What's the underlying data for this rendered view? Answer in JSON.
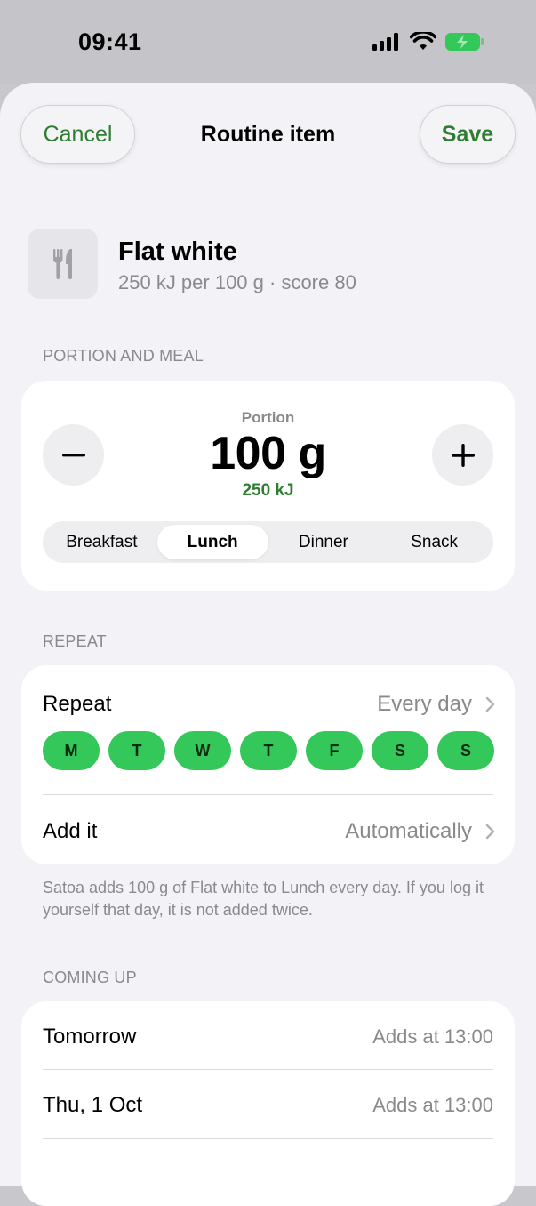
{
  "status_bar": {
    "time": "09:41"
  },
  "nav": {
    "cancel": "Cancel",
    "title": "Routine item",
    "save": "Save"
  },
  "food": {
    "name": "Flat white",
    "subtitle": "250 kJ per 100 g · score 80",
    "icon": "fork-knife-icon"
  },
  "portion_section": {
    "header": "PORTION AND MEAL",
    "label": "Portion",
    "value": "100 g",
    "energy": "250 kJ",
    "meals": [
      "Breakfast",
      "Lunch",
      "Dinner",
      "Snack"
    ],
    "selected_meal": "Lunch"
  },
  "repeat_section": {
    "header": "REPEAT",
    "repeat_label": "Repeat",
    "repeat_value": "Every day",
    "days": [
      "M",
      "T",
      "W",
      "T",
      "F",
      "S",
      "S"
    ],
    "add_label": "Add it",
    "add_value": "Automatically",
    "footnote": "Satoa adds 100 g of Flat white to Lunch every day. If you log it yourself that day, it is not added twice."
  },
  "coming_up": {
    "header": "COMING UP",
    "rows": [
      {
        "label": "Tomorrow",
        "value": "Adds at 13:00"
      },
      {
        "label": "Thu, 1 Oct",
        "value": "Adds at 13:00"
      }
    ]
  },
  "colors": {
    "accent": "#2e7d32",
    "day_chip": "#34c759",
    "background": "#f2f2f7"
  }
}
